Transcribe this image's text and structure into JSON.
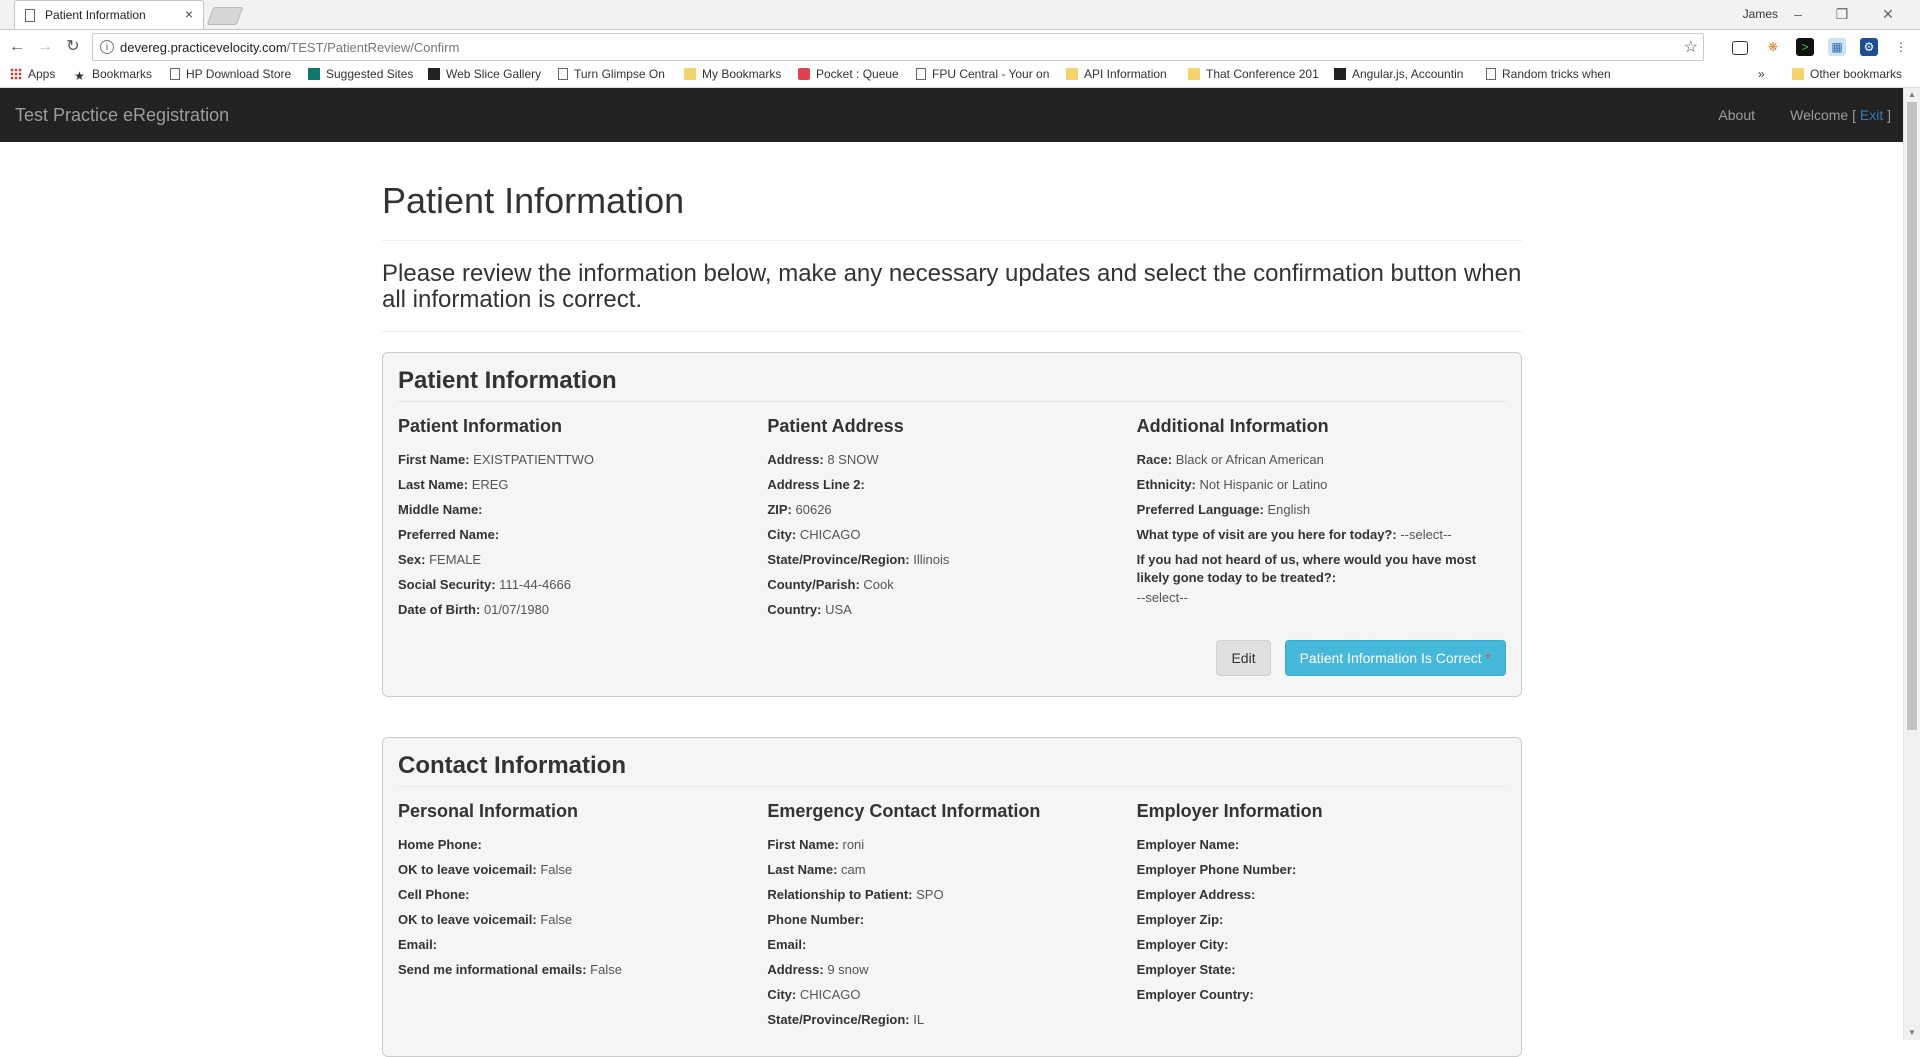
{
  "browser": {
    "tab_title": "Patient Information",
    "tab_close": "×",
    "user": "James",
    "url_host": "devereg.practicevelocity.com",
    "url_path": "/TEST/PatientReview/Confirm",
    "bookmarks": [
      {
        "label": "Apps",
        "icon": "apps-icon"
      },
      {
        "label": "Bookmarks",
        "icon": "star-icon"
      },
      {
        "label": "HP Download Store",
        "icon": "page-icon"
      },
      {
        "label": "Suggested Sites",
        "icon": "bing-icon"
      },
      {
        "label": "Web Slice Gallery",
        "icon": "web-slice-icon"
      },
      {
        "label": "Turn Glimpse On",
        "icon": "page-icon"
      },
      {
        "label": "My Bookmarks",
        "icon": "folder-icon"
      },
      {
        "label": "Pocket : Queue",
        "icon": "pocket-icon"
      },
      {
        "label": "FPU Central - Your on",
        "icon": "page-icon"
      },
      {
        "label": "API Information",
        "icon": "folder-icon"
      },
      {
        "label": "That Conference 201",
        "icon": "folder-icon"
      },
      {
        "label": "Angular.js, Accountin",
        "icon": "angular-icon"
      },
      {
        "label": "Random tricks when",
        "icon": "page-icon"
      }
    ],
    "more_bookmarks": "»",
    "other_bookmarks": "Other bookmarks"
  },
  "navbar": {
    "brand": "Test Practice eRegistration",
    "about": "About",
    "welcome_prefix": "Welcome [",
    "exit": "Exit",
    "welcome_suffix": "]"
  },
  "page": {
    "title": "Patient Information",
    "lead": "Please review the information below, make any necessary updates and select the confirmation button when all information is correct."
  },
  "patient_panel": {
    "title": "Patient Information",
    "patient": {
      "heading": "Patient Information",
      "fields": [
        {
          "label": "First Name:",
          "value": "EXISTPATIENTTWO"
        },
        {
          "label": "Last Name:",
          "value": "EREG"
        },
        {
          "label": "Middle Name:",
          "value": ""
        },
        {
          "label": "Preferred Name:",
          "value": ""
        },
        {
          "label": "Sex:",
          "value": "FEMALE"
        },
        {
          "label": "Social Security:",
          "value": "111-44-4666"
        },
        {
          "label": "Date of Birth:",
          "value": "01/07/1980"
        }
      ]
    },
    "address": {
      "heading": "Patient Address",
      "fields": [
        {
          "label": "Address:",
          "value": "8 SNOW"
        },
        {
          "label": "Address Line 2:",
          "value": ""
        },
        {
          "label": "ZIP:",
          "value": "60626"
        },
        {
          "label": "City:",
          "value": "CHICAGO"
        },
        {
          "label": "State/Province/Region:",
          "value": "Illinois"
        },
        {
          "label": "County/Parish:",
          "value": "Cook"
        },
        {
          "label": "Country:",
          "value": "USA"
        }
      ]
    },
    "additional": {
      "heading": "Additional Information",
      "fields": [
        {
          "label": "Race:",
          "value": "Black or African American"
        },
        {
          "label": "Ethnicity:",
          "value": "Not Hispanic or Latino"
        },
        {
          "label": "Preferred Language:",
          "value": "English"
        },
        {
          "label": "What type of visit are you here for today?:",
          "value": "--select--"
        },
        {
          "label": "If you had not heard of us, where would you have most likely gone today to be treated?:",
          "value": ""
        }
      ],
      "trailing_value": "--select--"
    },
    "edit_button": "Edit",
    "confirm_button": "Patient Information Is Correct",
    "required_marker": "*"
  },
  "contact_panel": {
    "title": "Contact Information",
    "personal": {
      "heading": "Personal Information",
      "fields": [
        {
          "label": "Home Phone:",
          "value": ""
        },
        {
          "label": "OK to leave voicemail:",
          "value": "False"
        },
        {
          "label": "Cell Phone:",
          "value": ""
        },
        {
          "label": "OK to leave voicemail:",
          "value": "False"
        },
        {
          "label": "Email:",
          "value": ""
        },
        {
          "label": "Send me informational emails:",
          "value": "False"
        }
      ]
    },
    "emergency": {
      "heading": "Emergency Contact Information",
      "fields": [
        {
          "label": "First Name:",
          "value": "roni"
        },
        {
          "label": "Last Name:",
          "value": "cam"
        },
        {
          "label": "Relationship to Patient:",
          "value": "SPO"
        },
        {
          "label": "Phone Number:",
          "value": ""
        },
        {
          "label": "Email:",
          "value": ""
        },
        {
          "label": "Address:",
          "value": "9 snow"
        },
        {
          "label": "City:",
          "value": "CHICAGO"
        },
        {
          "label": "State/Province/Region:",
          "value": "IL"
        }
      ]
    },
    "employer": {
      "heading": "Employer Information",
      "fields": [
        {
          "label": "Employer Name:",
          "value": ""
        },
        {
          "label": "Employer Phone Number:",
          "value": ""
        },
        {
          "label": "Employer Address:",
          "value": ""
        },
        {
          "label": "Employer Zip:",
          "value": ""
        },
        {
          "label": "Employer City:",
          "value": ""
        },
        {
          "label": "Employer State:",
          "value": ""
        },
        {
          "label": "Employer Country:",
          "value": ""
        }
      ]
    }
  }
}
